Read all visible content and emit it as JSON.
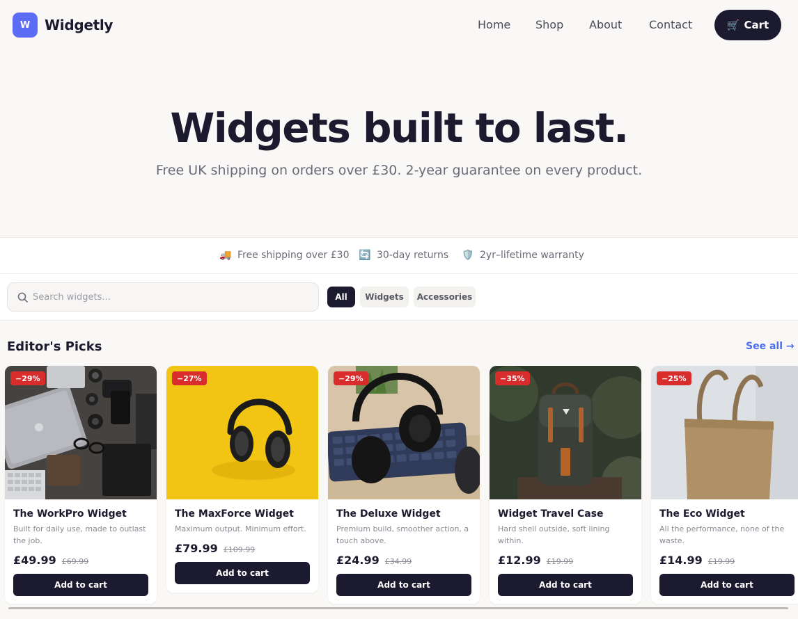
{
  "header": {
    "logo_letter": "W",
    "brand": "Widgetly",
    "nav": [
      "Home",
      "Shop",
      "About",
      "Contact"
    ],
    "cart_label": "Cart",
    "cart_icon": "shopping-cart-icon"
  },
  "hero": {
    "title": "Widgets built to last.",
    "subtitle": "Free UK shipping on orders over £30. 2-year guarantee on every product."
  },
  "perks": [
    {
      "icon": "delivery-truck-icon",
      "glyph": "🚚",
      "label": "Free shipping over £30"
    },
    {
      "icon": "returns-arrows-icon",
      "glyph": "🔄",
      "label": "30-day returns"
    },
    {
      "icon": "shield-icon",
      "glyph": "🛡️",
      "label": "2yr–lifetime warranty"
    }
  ],
  "filters": {
    "search_placeholder": "Search widgets...",
    "search_value": "",
    "chips": [
      "All",
      "Widgets",
      "Accessories"
    ],
    "active_chip": "All"
  },
  "section": {
    "title": "Editor's Picks",
    "see_all": "See all →"
  },
  "products": [
    {
      "badge": "−29%",
      "name": "The WorkPro Widget",
      "desc": "Built for daily use, made to outlast the job.",
      "price": "£49.99",
      "old_price": "£69.99",
      "button": "Add to cart",
      "image": "desk-laptop-cameras"
    },
    {
      "badge": "−27%",
      "name": "The MaxForce Widget",
      "desc": "Maximum output. Minimum effort.",
      "price": "£79.99",
      "old_price": "£109.99",
      "button": "Add to cart",
      "image": "headphones-yellow"
    },
    {
      "badge": "−29%",
      "name": "The Deluxe Widget",
      "desc": "Premium build, smoother action, a touch above.",
      "price": "£24.99",
      "old_price": "£34.99",
      "button": "Add to cart",
      "image": "headphones-keyboard"
    },
    {
      "badge": "−35%",
      "name": "Widget Travel Case",
      "desc": "Hard shell outside, soft lining within.",
      "price": "£12.99",
      "old_price": "£19.99",
      "button": "Add to cart",
      "image": "backpack"
    },
    {
      "badge": "−25%",
      "name": "The Eco Widget",
      "desc": "All the performance, none of the waste.",
      "price": "£14.99",
      "old_price": "£19.99",
      "button": "Add to cart",
      "image": "tote-bag"
    }
  ],
  "colors": {
    "accent": "#5b6cf5",
    "dark": "#1b1a2e",
    "badge": "#d92c2c",
    "link": "#4a6cf0",
    "page_bg": "#faf8f6"
  }
}
